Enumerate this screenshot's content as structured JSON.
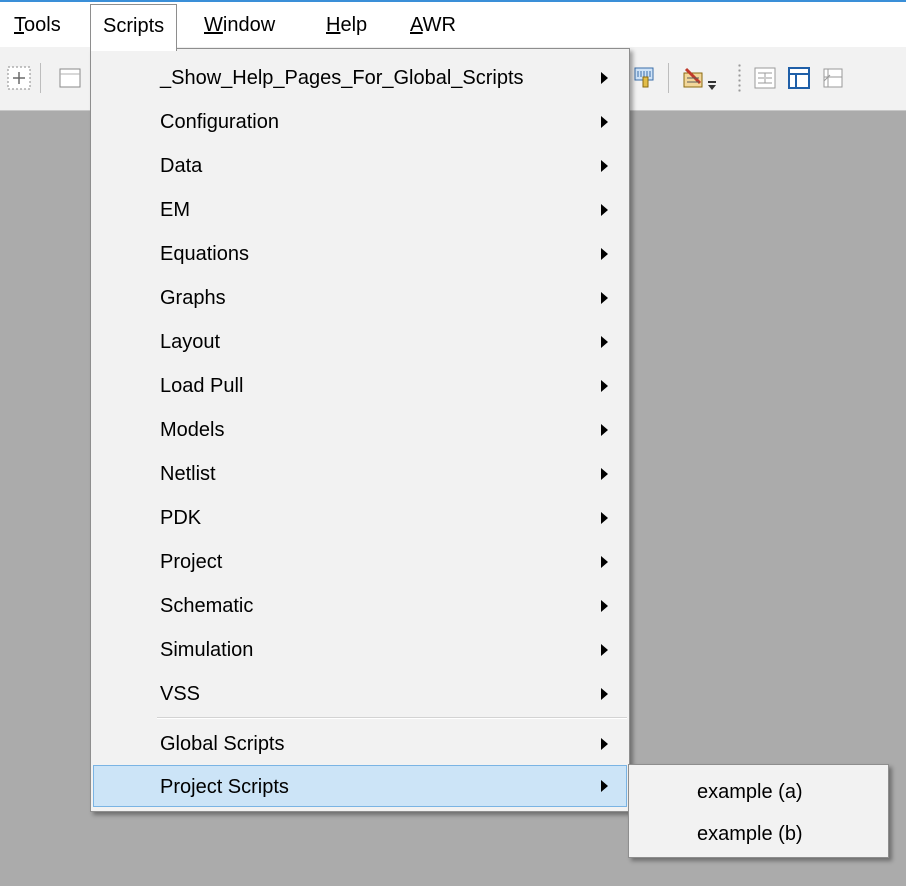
{
  "menubar": {
    "tools": "Tools",
    "tools_accel": "T",
    "tools_rest": "ools",
    "scripts": "Scripts",
    "window_accel": "W",
    "window_rest": "indow",
    "help_accel": "H",
    "help_rest": "elp",
    "awr_accel": "A",
    "awr_rest": "WR"
  },
  "dropdown": {
    "items": [
      "_Show_Help_Pages_For_Global_Scripts",
      "Configuration",
      "Data",
      "EM",
      "Equations",
      "Graphs",
      "Layout",
      "Load Pull",
      "Models",
      "Netlist",
      "PDK",
      "Project",
      "Schematic",
      "Simulation",
      "VSS"
    ],
    "global_scripts": "Global Scripts",
    "project_scripts": "Project Scripts"
  },
  "submenu": {
    "items": [
      "example (a)",
      "example (b)"
    ]
  },
  "colors": {
    "highlight": "#cce4f7",
    "highlight_border": "#7ab4e4",
    "workspace": "#ababab",
    "menubar_accent": "#3a8fd8"
  }
}
